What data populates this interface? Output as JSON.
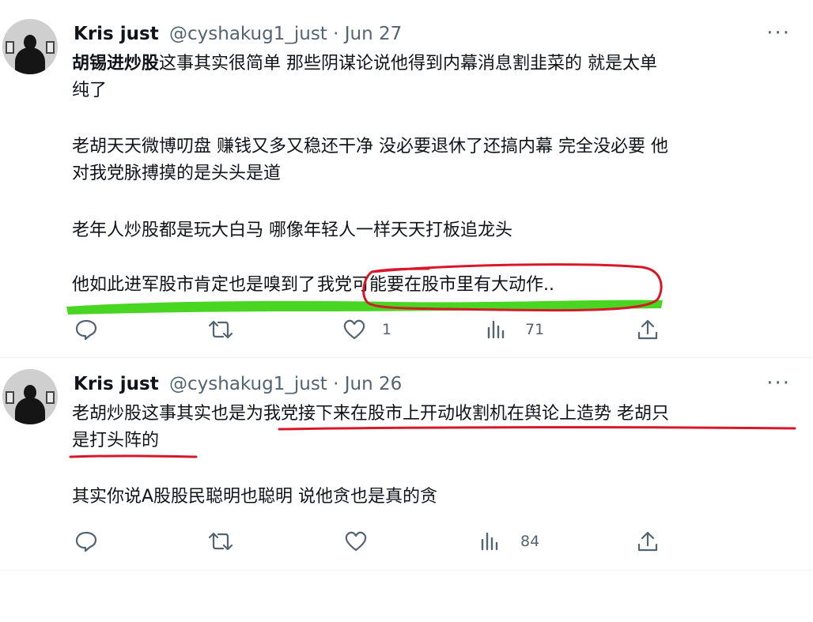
{
  "tweets": [
    {
      "author_name": "Kris just",
      "author_handle": "@cyshakug1_just",
      "separator": " · ",
      "date": "Jun 27",
      "more_label": "···",
      "paragraphs": {
        "p1_hashtag": "胡锡进炒股",
        "p1_line1_rest": "这事其实很简单 那些阴谋论说他得到内幕消息割韭菜的 就是太单",
        "p1_line2": "纯了",
        "p2_line1": "老胡天天微博叨盘 赚钱又多又稳还干净 没必要退休了还搞内幕 完全没必要 他",
        "p2_line2": "对我党脉搏摸的是头头是道",
        "p3": "老年人炒股都是玩大白马 哪像年轻人一样天天打板追龙头",
        "p4_part1": "他如此进军股市肯定也是嗅到了",
        "p4_part2": "我党可能要在股市里有大动作.."
      },
      "actions": {
        "reply_count": "",
        "retweet_count": "",
        "like_count": "1",
        "views_count": "71"
      }
    },
    {
      "author_name": "Kris just",
      "author_handle": "@cyshakug1_just",
      "separator": " · ",
      "date": "Jun 26",
      "more_label": "···",
      "paragraphs": {
        "p1_line1_a": "老胡炒股这事其实也是",
        "p1_line1_b": "为我党接下来在股市上开动收割机在舆论上造势 老胡只",
        "p1_line2": "是打头阵的",
        "p2": "其实你说A股股民聪明也聪明 说他贪也是真的贪"
      },
      "actions": {
        "reply_count": "",
        "retweet_count": "",
        "like_count": "",
        "views_count": "84"
      }
    }
  ],
  "icons": {
    "reply": "reply-bubble-icon",
    "retweet": "retweet-arrows-icon",
    "like": "heart-icon",
    "views": "bar-chart-icon",
    "share": "share-upload-icon"
  },
  "annotation_colors": {
    "green_highlight": "#3ed416",
    "red_marker": "#d6182a"
  }
}
